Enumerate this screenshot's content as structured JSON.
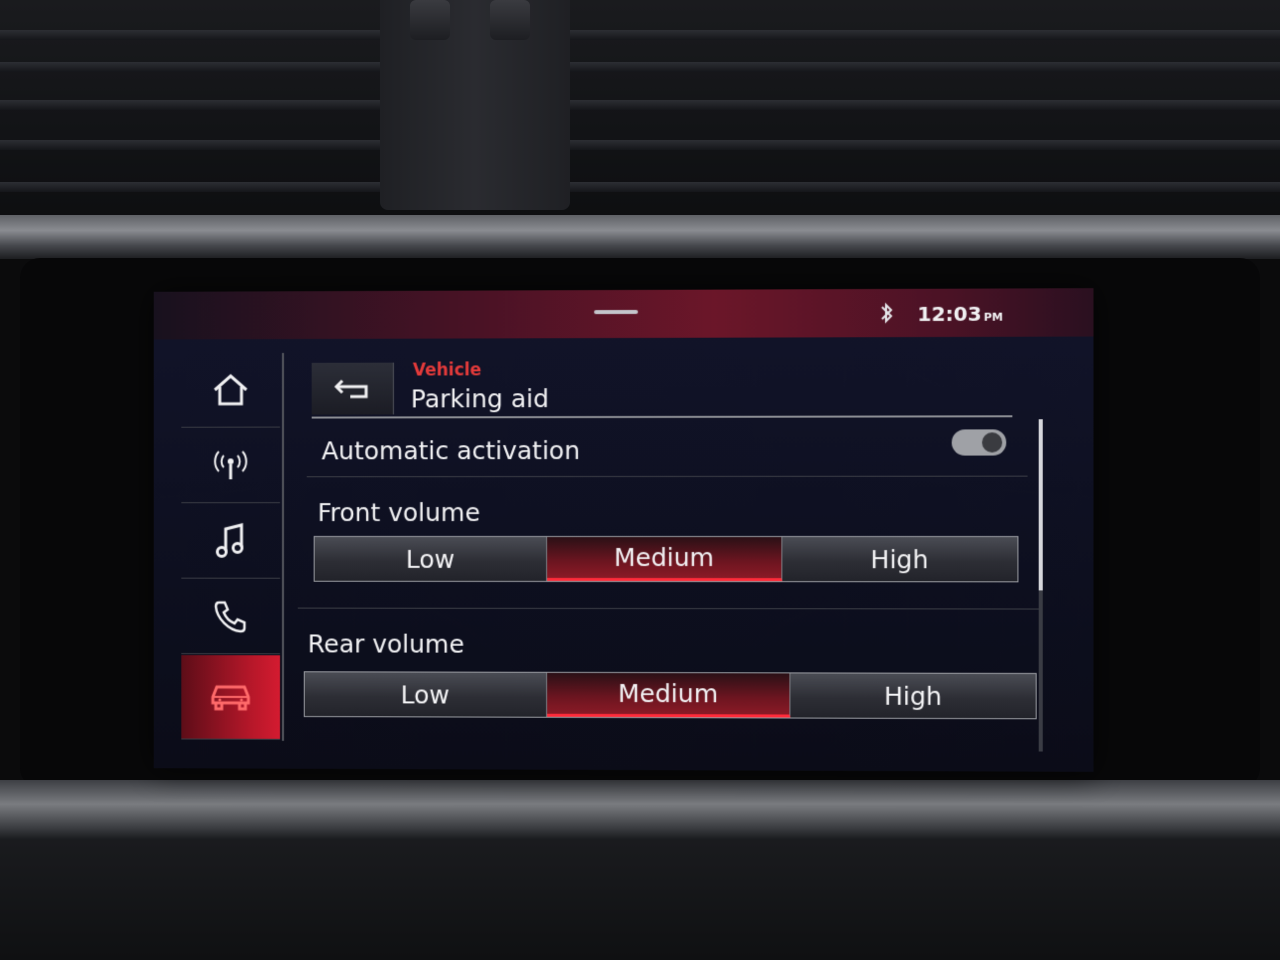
{
  "status_bar": {
    "time": "12:03",
    "ampm": "PM",
    "bluetooth_icon": "bluetooth-icon"
  },
  "sidebar": {
    "items": [
      {
        "icon": "home-icon",
        "active": false
      },
      {
        "icon": "radio-antenna-icon",
        "active": false
      },
      {
        "icon": "music-note-icon",
        "active": false
      },
      {
        "icon": "phone-icon",
        "active": false
      },
      {
        "icon": "car-icon",
        "active": true
      }
    ]
  },
  "header": {
    "breadcrumb": "Vehicle",
    "title": "Parking aid",
    "back_icon": "back-arrow-icon"
  },
  "settings": {
    "automatic_activation": {
      "label": "Automatic activation",
      "enabled": true
    },
    "front_volume": {
      "label": "Front volume",
      "options": [
        "Low",
        "Medium",
        "High"
      ],
      "selected": "Medium"
    },
    "rear_volume": {
      "label": "Rear volume",
      "options": [
        "Low",
        "Medium",
        "High"
      ],
      "selected": "Medium"
    }
  },
  "colors": {
    "accent": "#e23a3a",
    "active_tab": "#b51729",
    "screen_bg": "#0d0f1f"
  }
}
